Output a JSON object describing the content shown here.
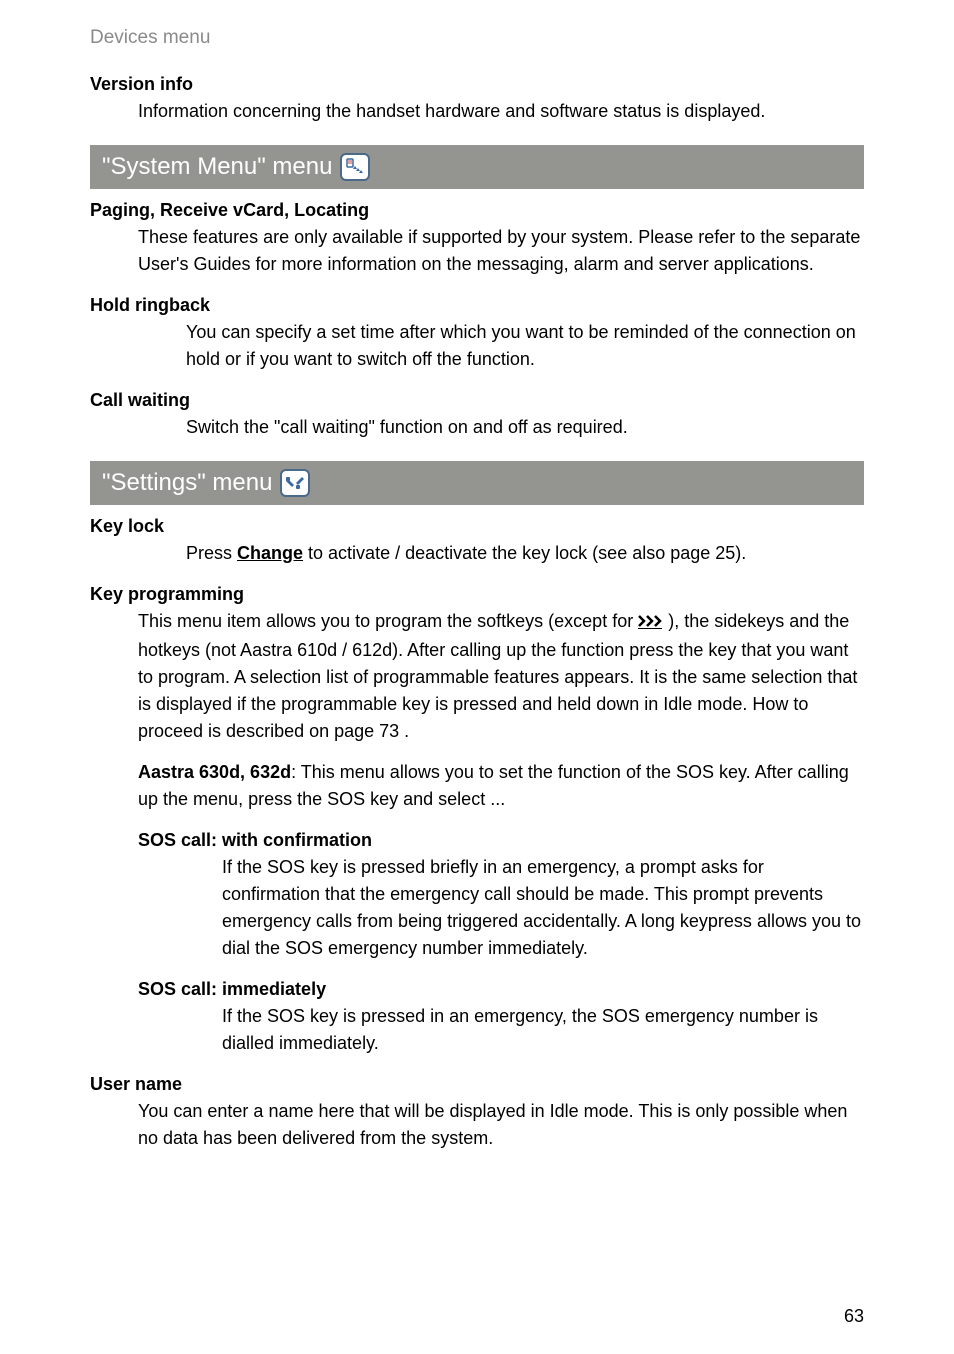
{
  "running_header": "Devices menu",
  "section_version_info": {
    "title": "Version info",
    "body": "Information concerning the handset hardware and software status is displayed."
  },
  "menu_system": {
    "bar_label": "\"System Menu\" menu",
    "paging": {
      "title": "Paging, Receive vCard, Locating",
      "body": "These features are only available if supported by your system. Please refer to the separate User's Guides for more information on the messaging, alarm and server applications."
    },
    "hold_ringback": {
      "title": "Hold ringback",
      "body": "You can specify a set time after which you want to be reminded of the connection on hold or if you want to switch off the function."
    },
    "call_waiting": {
      "title": "Call waiting",
      "body": "Switch the \"call waiting\" function on and off as required."
    }
  },
  "menu_settings": {
    "bar_label": "\"Settings\" menu",
    "key_lock": {
      "title": "Key lock",
      "body_prefix": "Press ",
      "softkey_label": "Change",
      "body_suffix": " to activate / deactivate the key lock (see also page 25)."
    },
    "key_programming": {
      "title": "Key programming",
      "body1_prefix": "This menu item allows you to program the softkeys (except for ",
      "body1_suffix": "), the sidekeys and the hotkeys (not Aastra 610d / 612d). After calling up the function press the key that you want to program. A selection list of programmable features appears. It is the same selection that is displayed if the programmable key is pressed and held down in Idle mode. How to proceed is described on page 73 .",
      "body2_bold": "Aastra 630d, 632d",
      "body2_rest": ": This menu allows you to set the function of the SOS key. After calling up the menu, press the SOS key and select ...",
      "sos_confirm": {
        "title": "SOS call: with confirmation",
        "body": "If the SOS key is pressed briefly in an emergency, a prompt asks for confirmation that the emergency call should be made. This prompt prevents emergency calls from being triggered accidentally. A long keypress allows you to dial the SOS emergency number immediately."
      },
      "sos_immediate": {
        "title": "SOS call: immediately",
        "body": "If the SOS key is pressed in an emergency, the SOS emergency number is dialled immediately."
      }
    },
    "user_name": {
      "title": "User name",
      "body": "You can enter a name here that will be displayed in Idle mode. This is only possible when no data has been delivered from the system."
    }
  },
  "page_number": "63"
}
